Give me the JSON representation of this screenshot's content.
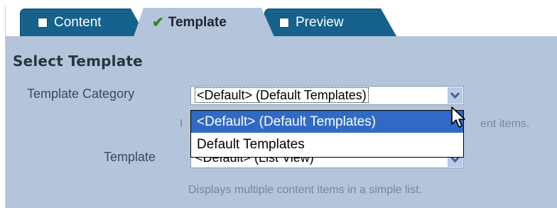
{
  "tabs": [
    {
      "label": "Content",
      "state": "inactive",
      "icon": "square-icon"
    },
    {
      "label": "Template",
      "state": "active",
      "icon": "check-icon"
    },
    {
      "label": "Preview",
      "state": "inactive",
      "icon": "square-icon"
    }
  ],
  "section_title": "Select Template",
  "category": {
    "label": "Template Category",
    "selected": "<Default> (Default Templates)",
    "help_partial": "ent items.",
    "options": [
      "<Default> (Default Templates)",
      "Default Templates"
    ],
    "highlighted_option": "<Default> (Default Templates)"
  },
  "template": {
    "label": "Template",
    "selected": "<Default> (List View)",
    "help": "Displays multiple content items in a simple list."
  },
  "colors": {
    "tab_inactive": "#17628c",
    "panel": "#b4c4db",
    "selection": "#316ac5"
  }
}
